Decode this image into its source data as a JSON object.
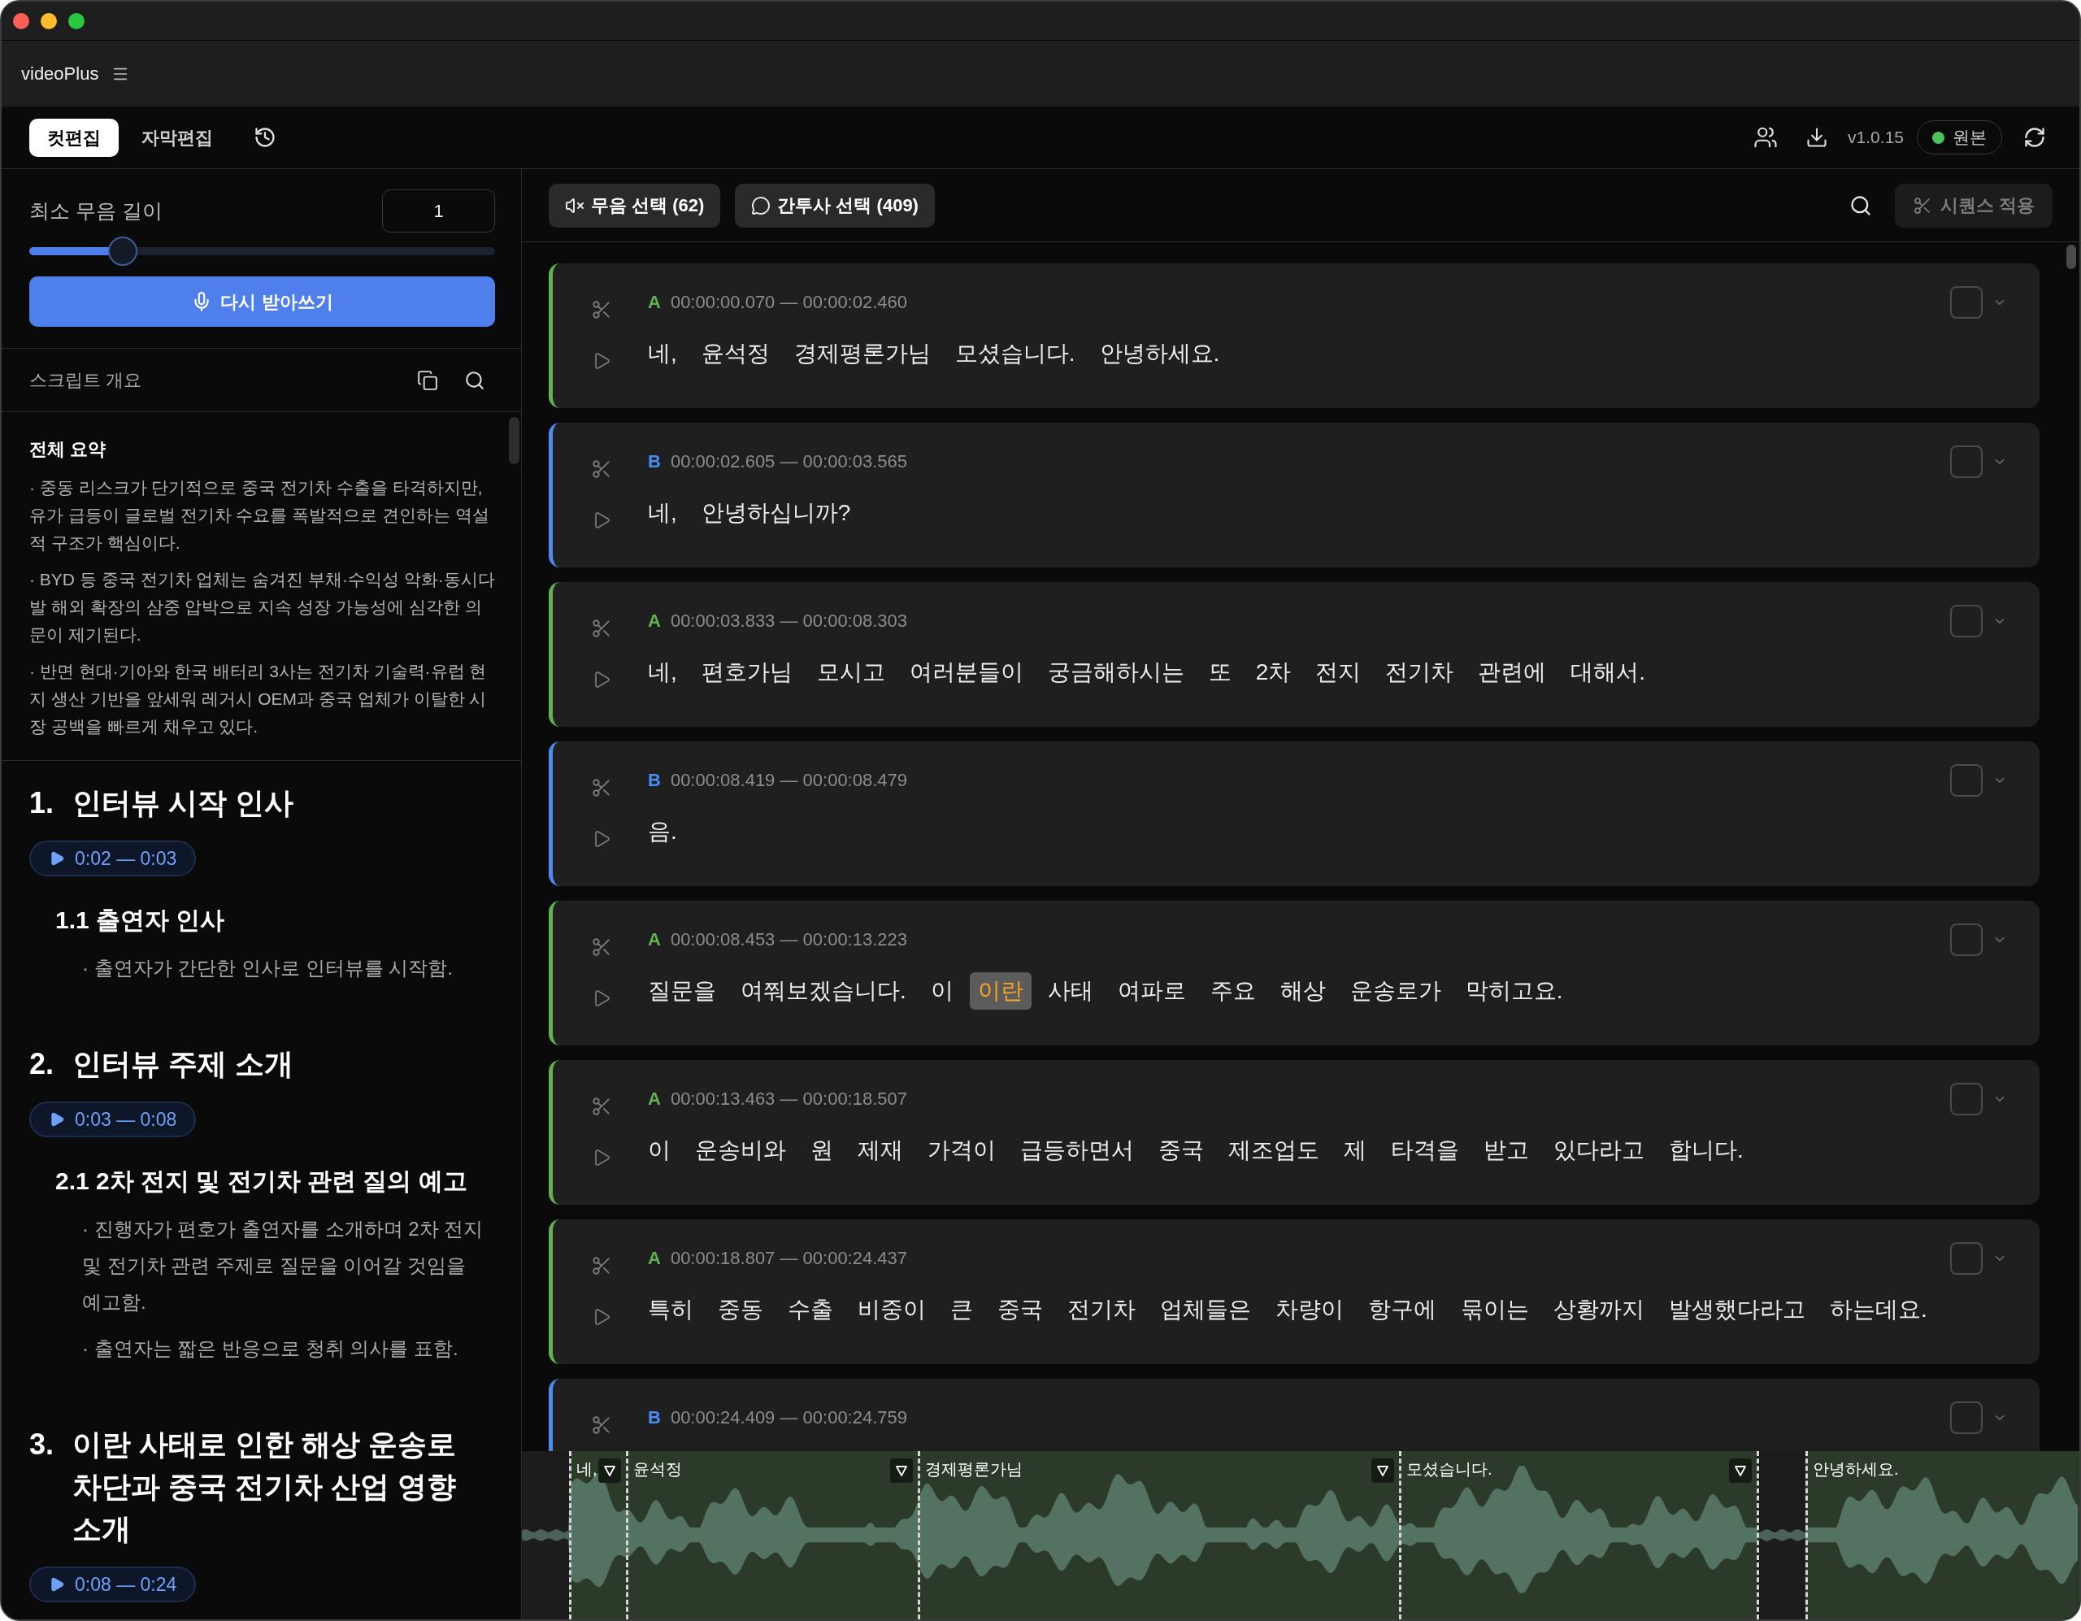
{
  "app": {
    "name": "videoPlus"
  },
  "tabs": [
    {
      "label": "컷편집",
      "selected": true
    },
    {
      "label": "자막편집",
      "selected": false
    }
  ],
  "header": {
    "version": "v1.0.15",
    "source": "원본"
  },
  "silence_settings": {
    "label": "최소 무음 길이",
    "value": "1",
    "level": 0.2,
    "button": "다시 받아쓰기"
  },
  "outline": {
    "title": "스크립트 개요",
    "summary": {
      "title": "전체 요약",
      "bullets": [
        "· 중동 리스크가 단기적으로 중국 전기차 수출을 타격하지만, 유가 급등이 글로벌 전기차 수요를 폭발적으로 견인하는 역설적 구조가 핵심이다.",
        "· BYD 등 중국 전기차 업체는 숨겨진 부채·수익성 악화·동시다발 해외 확장의 삼중 압박으로 지속 성장 가능성에 심각한 의문이 제기된다.",
        "· 반면 현대·기아와 한국 배터리 3사는 전기차 기술력·유럽 현지 생산 기반을 앞세워 레거시 OEM과 중국 업체가 이탈한 시장 공백을 빠르게 채우고 있다."
      ]
    },
    "sections": [
      {
        "number": "1.",
        "title": "인터뷰 시작 인사",
        "time": "0:02 — 0:03",
        "subsections": [
          {
            "title": "1.1 출연자 인사",
            "bullets": [
              "· 출연자가 간단한 인사로 인터뷰를 시작함."
            ]
          }
        ]
      },
      {
        "number": "2.",
        "title": "인터뷰 주제 소개",
        "time": "0:03 — 0:08",
        "subsections": [
          {
            "title": "2.1 2차 전지 및 전기차 관련 질의 예고",
            "bullets": [
              "· 진행자가 편호가 출연자를 소개하며 2차 전지 및 전기차 관련 주제로 질문을 이어갈 것임을 예고함.",
              "· 출연자는 짧은 반응으로 청취 의사를 표함."
            ]
          }
        ]
      },
      {
        "number": "3.",
        "title": "이란 사태로 인한 해상 운송로 차단과 중국 전기차 산업 영향 소개",
        "time": "0:08 — 0:24"
      }
    ]
  },
  "toolbar": {
    "filters": [
      {
        "kind": "silence",
        "label": "무음 선택 (62)"
      },
      {
        "kind": "filler",
        "label": "간투사 선택 (409)"
      }
    ],
    "apply": {
      "label": "시퀀스 적용",
      "disabled": true
    }
  },
  "rows": [
    {
      "speaker": "A",
      "color": "#62b34f",
      "time": "00:00:00.070 — 00:00:02.460",
      "checked": false,
      "words": [
        {
          "text": "네,",
          "highlighted": false
        },
        {
          "text": "윤석정",
          "highlighted": false
        },
        {
          "text": "경제평론가님",
          "highlighted": false
        },
        {
          "text": "모셨습니다.",
          "highlighted": false
        },
        {
          "text": "안녕하세요.",
          "highlighted": false
        }
      ]
    },
    {
      "speaker": "B",
      "color": "#4a8cf0",
      "time": "00:00:02.605 — 00:00:03.565",
      "checked": false,
      "words": [
        {
          "text": "네,",
          "highlighted": false
        },
        {
          "text": "안녕하십니까?",
          "highlighted": false
        }
      ]
    },
    {
      "speaker": "A",
      "color": "#62b34f",
      "time": "00:00:03.833 — 00:00:08.303",
      "checked": false,
      "words": [
        {
          "text": "네,",
          "highlighted": false
        },
        {
          "text": "편호가님",
          "highlighted": false
        },
        {
          "text": "모시고",
          "highlighted": false
        },
        {
          "text": "여러분들이",
          "highlighted": false
        },
        {
          "text": "궁금해하시는",
          "highlighted": false
        },
        {
          "text": "또",
          "highlighted": false
        },
        {
          "text": "2차",
          "highlighted": false
        },
        {
          "text": "전지",
          "highlighted": false
        },
        {
          "text": "전기차",
          "highlighted": false
        },
        {
          "text": "관련에",
          "highlighted": false
        },
        {
          "text": "대해서.",
          "highlighted": false
        }
      ]
    },
    {
      "speaker": "B",
      "color": "#4a8cf0",
      "time": "00:00:08.419 — 00:00:08.479",
      "checked": false,
      "words": [
        {
          "text": "음.",
          "highlighted": false
        }
      ]
    },
    {
      "speaker": "A",
      "color": "#62b34f",
      "time": "00:00:08.453 — 00:00:13.223",
      "checked": false,
      "words": [
        {
          "text": "질문을",
          "highlighted": false
        },
        {
          "text": "여쭤보겠습니다.",
          "highlighted": false
        },
        {
          "text": "이",
          "highlighted": false
        },
        {
          "text": "이란",
          "highlighted": true
        },
        {
          "text": "사태",
          "highlighted": false
        },
        {
          "text": "여파로",
          "highlighted": false
        },
        {
          "text": "주요",
          "highlighted": false
        },
        {
          "text": "해상",
          "highlighted": false
        },
        {
          "text": "운송로가",
          "highlighted": false
        },
        {
          "text": "막히고요.",
          "highlighted": false
        }
      ]
    },
    {
      "speaker": "A",
      "color": "#62b34f",
      "time": "00:00:13.463 — 00:00:18.507",
      "checked": false,
      "words": [
        {
          "text": "이",
          "highlighted": false
        },
        {
          "text": "운송비와",
          "highlighted": false
        },
        {
          "text": "원",
          "highlighted": false
        },
        {
          "text": "제재",
          "highlighted": false
        },
        {
          "text": "가격이",
          "highlighted": false
        },
        {
          "text": "급등하면서",
          "highlighted": false
        },
        {
          "text": "중국",
          "highlighted": false
        },
        {
          "text": "제조업도",
          "highlighted": false
        },
        {
          "text": "제",
          "highlighted": false
        },
        {
          "text": "타격을",
          "highlighted": false
        },
        {
          "text": "받고",
          "highlighted": false
        },
        {
          "text": "있다라고",
          "highlighted": false
        },
        {
          "text": "합니다.",
          "highlighted": false
        }
      ]
    },
    {
      "speaker": "A",
      "color": "#62b34f",
      "time": "00:00:18.807 — 00:00:24.437",
      "checked": false,
      "words": [
        {
          "text": "특히",
          "highlighted": false
        },
        {
          "text": "중동",
          "highlighted": false
        },
        {
          "text": "수출",
          "highlighted": false
        },
        {
          "text": "비중이",
          "highlighted": false
        },
        {
          "text": "큰",
          "highlighted": false
        },
        {
          "text": "중국",
          "highlighted": false
        },
        {
          "text": "전기차",
          "highlighted": false
        },
        {
          "text": "업체들은",
          "highlighted": false
        },
        {
          "text": "차량이",
          "highlighted": false
        },
        {
          "text": "항구에",
          "highlighted": false
        },
        {
          "text": "묶이는",
          "highlighted": false
        },
        {
          "text": "상황까지",
          "highlighted": false
        },
        {
          "text": "발생했다라고",
          "highlighted": false
        },
        {
          "text": "하는데요.",
          "highlighted": false
        }
      ]
    },
    {
      "speaker": "B",
      "color": "#4a8cf0",
      "time": "00:00:24.409 — 00:00:24.759",
      "checked": false
    }
  ],
  "waveform": {
    "segments": [
      {
        "kind": "silence"
      },
      {
        "kind": "speech",
        "label": "네,",
        "marker": true
      },
      {
        "kind": "speech",
        "label": "윤석정",
        "marker": true
      },
      {
        "kind": "speech",
        "label": "경제평론가님",
        "marker": true
      },
      {
        "kind": "speech",
        "label": "모셨습니다.",
        "marker": true
      },
      {
        "kind": "silence"
      },
      {
        "kind": "speech",
        "label": "안녕하세요."
      }
    ]
  }
}
